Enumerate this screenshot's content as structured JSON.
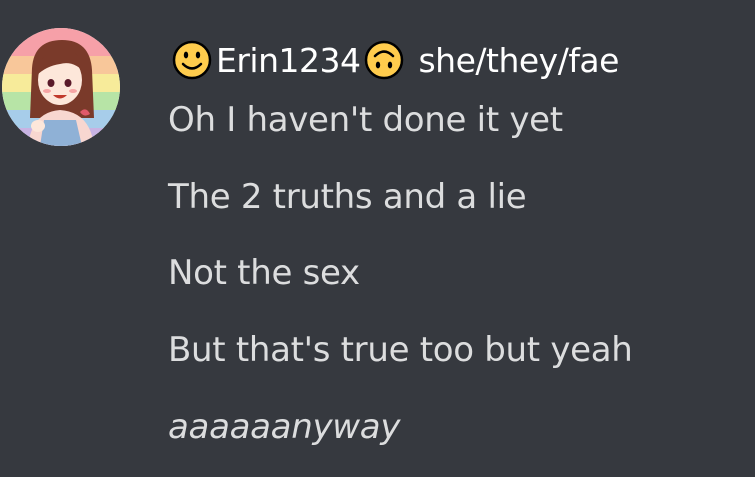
{
  "author": {
    "username": "Erin1234",
    "pronouns": "she/they/fae",
    "emoji_before": "smiling-face-icon",
    "emoji_after": "upside-down-face-icon",
    "avatar": "avatar-girl-pride-flag"
  },
  "messages": [
    {
      "text": "Oh I haven't done it yet",
      "italic": false
    },
    {
      "text": "The 2 truths and a lie",
      "italic": false
    },
    {
      "text": "Not the sex",
      "italic": false
    },
    {
      "text": "But that's true too but yeah",
      "italic": false
    },
    {
      "text": "aaaaaanyway",
      "italic": true
    }
  ],
  "colors": {
    "background": "#36393f",
    "username": "#ffffff",
    "message_text": "#dcddde",
    "emoji_yellow": "#ffcc4d"
  }
}
